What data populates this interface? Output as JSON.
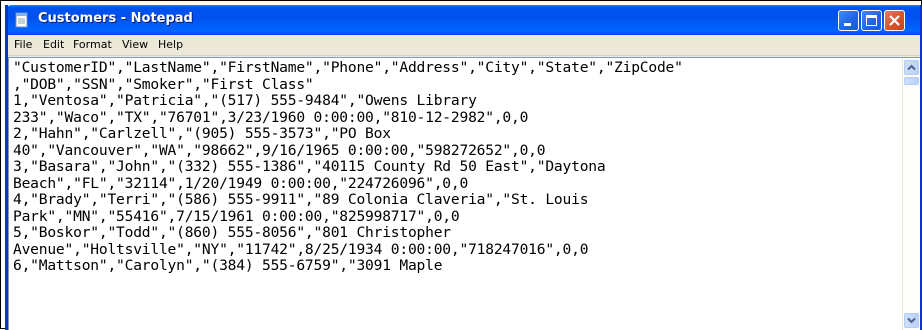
{
  "window": {
    "title": "Customers - Notepad",
    "title_color": "#ffffff",
    "titlebar_color": "#0055ea",
    "app_icon": "notepad-icon"
  },
  "controls": {
    "minimize_icon": "minimize-icon",
    "maximize_icon": "maximize-icon",
    "close_icon": "close-icon"
  },
  "menu": {
    "items": [
      "File",
      "Edit",
      "Format",
      "View",
      "Help"
    ]
  },
  "document": {
    "lines": [
      "\"CustomerID\",\"LastName\",\"FirstName\",\"Phone\",\"Address\",\"City\",\"State\",\"ZipCode\"",
      ",\"DOB\",\"SSN\",\"Smoker\",\"First Class\"",
      "1,\"Ventosa\",\"Patricia\",\"(517) 555-9484\",\"Owens Library",
      "233\",\"Waco\",\"TX\",\"76701\",3/23/1960 0:00:00,\"810-12-2982\",0,0",
      "2,\"Hahn\",\"Carlzell\",\"(905) 555-3573\",\"PO Box",
      "40\",\"Vancouver\",\"WA\",\"98662\",9/16/1965 0:00:00,\"598272652\",0,0",
      "3,\"Basara\",\"John\",\"(332) 555-1386\",\"40115 County Rd 50 East\",\"Daytona",
      "Beach\",\"FL\",\"32114\",1/20/1949 0:00:00,\"224726096\",0,0",
      "4,\"Brady\",\"Terri\",\"(586) 555-9911\",\"89 Colonia Claveria\",\"St. Louis",
      "Park\",\"MN\",\"55416\",7/15/1961 0:00:00,\"825998717\",0,0",
      "5,\"Boskor\",\"Todd\",\"(860) 555-8056\",\"801 Christopher",
      "Avenue\",\"Holtsville\",\"NY\",\"11742\",8/25/1934 0:00:00,\"718247016\",0,0",
      "6,\"Mattson\",\"Carolyn\",\"(384) 555-6759\",\"3091 Maple"
    ]
  },
  "scrollbar": {
    "up_icon": "scroll-up-arrow-icon",
    "down_icon": "scroll-down-arrow-icon"
  }
}
